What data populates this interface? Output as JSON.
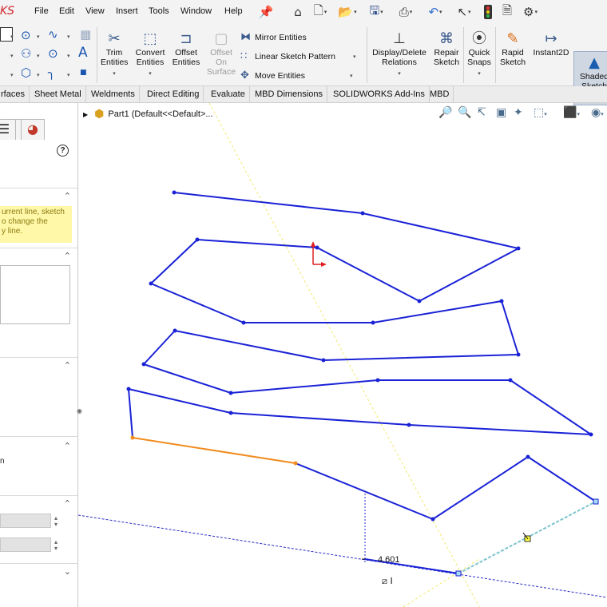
{
  "app": {
    "logo": "KS"
  },
  "menubar": {
    "items": [
      "File",
      "Edit",
      "View",
      "Insert",
      "Tools",
      "Window",
      "Help"
    ]
  },
  "quick_access": {
    "icons": [
      "pin-icon",
      "home-icon",
      "new-document-icon",
      "open-icon",
      "save-icon",
      "print-icon",
      "undo-icon",
      "select-icon",
      "traffic-light-icon",
      "file-properties-icon",
      "options-gear-icon"
    ]
  },
  "toolbar": {
    "trim": "Trim Entities",
    "convert": "Convert Entities",
    "offset": "Offset Entities",
    "offset_surface": "Offset On Surface",
    "mirror": "Mirror Entities",
    "linear_pattern": "Linear Sketch Pattern",
    "move": "Move Entities",
    "display_relations": "Display/Delete Relations",
    "repair": "Repair Sketch",
    "quick_snaps": "Quick Snaps",
    "rapid_sketch": "Rapid Sketch",
    "instant2d": "Instant2D",
    "shaded_contours": "Shaded Sketch Contours"
  },
  "tabs": [
    "rfaces",
    "Sheet Metal",
    "Weldments",
    "Direct Editing",
    "Evaluate",
    "MBD Dimensions",
    "SOLIDWORKS Add-Ins",
    "MBD"
  ],
  "left_panel": {
    "message_lines": [
      "urrent line, sketch",
      "o change the",
      "y line."
    ],
    "help_glyph": "?",
    "unit_fragment": "n"
  },
  "tree": {
    "label": "Part1  (Default<<Default>..."
  },
  "dimension": {
    "value": "4.601"
  },
  "colors": {
    "sketch_line": "#1a22d6",
    "selected_line": "#f08c1e",
    "preview_line": "#7cc4cc",
    "axis_line": "#2a2ac8",
    "plane_line": "#f2e96a",
    "message_bg": "#fff8a8"
  }
}
